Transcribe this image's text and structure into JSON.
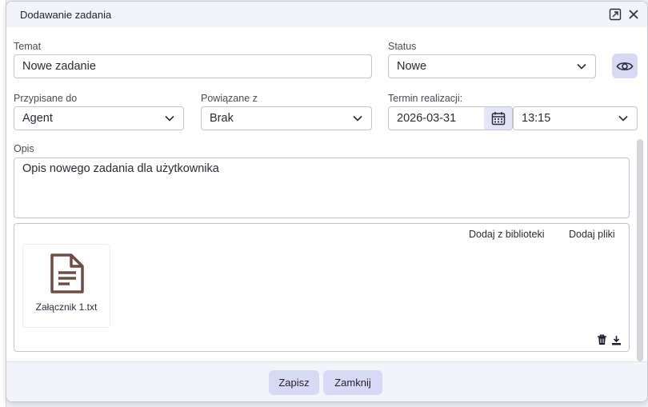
{
  "dialog": {
    "title": "Dodawanie zadania"
  },
  "form": {
    "subject": {
      "label": "Temat",
      "value": "Nowe zadanie"
    },
    "status": {
      "label": "Status",
      "value": "Nowe"
    },
    "assigned_to": {
      "label": "Przypisane do",
      "value": "Agent"
    },
    "related_to": {
      "label": "Powiązane z",
      "value": "Brak"
    },
    "due": {
      "label": "Termin realizacji:",
      "date": "2026-03-31",
      "time": "13:15"
    },
    "description": {
      "label": "Opis",
      "value": "Opis nowego zadania dla użytkownika"
    }
  },
  "attachments": {
    "add_from_library": "Dodaj z biblioteki",
    "add_files": "Dodaj pliki",
    "files": [
      {
        "name": "Załącznik 1.txt",
        "icon": "text-file-icon"
      }
    ]
  },
  "footer": {
    "save_label": "Zapisz",
    "close_label": "Zamknij"
  },
  "colors": {
    "accent_button": "#d8d9f5",
    "titlebar": "#f3f3fa",
    "file_icon": "#6b4f45"
  }
}
